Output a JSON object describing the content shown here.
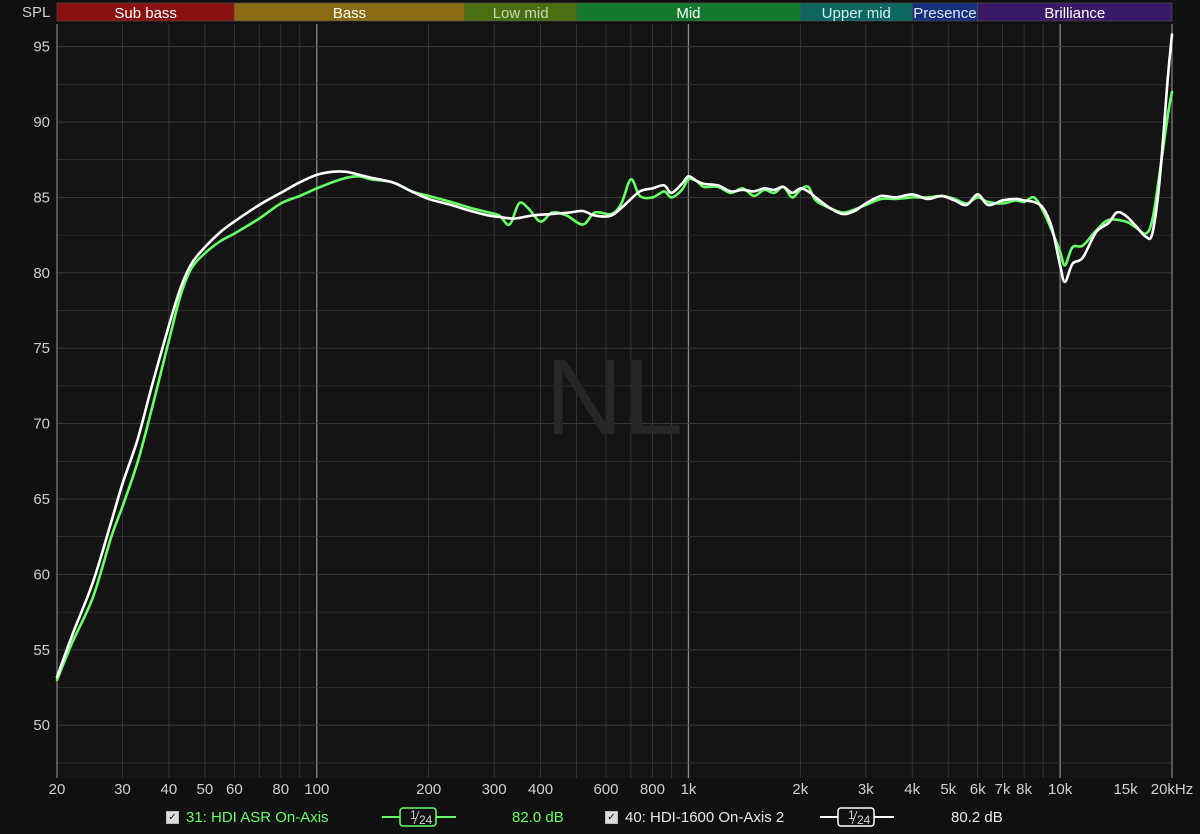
{
  "colors": {
    "background": "#101010",
    "plot_background": "#141414",
    "grid": "#3a3a3a",
    "series1": "#66ff66",
    "series2": "#ffffff",
    "watermark": "#262626"
  },
  "watermark": "NL",
  "bands": [
    {
      "label": "Sub bass",
      "from": 20,
      "to": 60,
      "color": "#8b1010",
      "text": "#ffffff"
    },
    {
      "label": "Bass",
      "from": 60,
      "to": 250,
      "color": "#8a6a12",
      "text": "#ffffff"
    },
    {
      "label": "Low mid",
      "from": 250,
      "to": 500,
      "color": "#4a6e12",
      "text": "#c8d8b0"
    },
    {
      "label": "Mid",
      "from": 500,
      "to": 2000,
      "color": "#137a2d",
      "text": "#ffffff"
    },
    {
      "label": "Upper mid",
      "from": 2000,
      "to": 4000,
      "color": "#0e6660",
      "text": "#d0f0f0"
    },
    {
      "label": "Presence",
      "from": 4000,
      "to": 6000,
      "color": "#15307a",
      "text": "#e0e8ff"
    },
    {
      "label": "Brilliance",
      "from": 6000,
      "to": 20000,
      "color": "#3a1a66",
      "text": "#ffffff"
    }
  ],
  "legend": [
    {
      "checkbox": "✓",
      "label": "31: HDI ASR On-Axis",
      "smoothing_num": "1",
      "smoothing_den": "24",
      "level": "82.0 dB",
      "color": "#66ff66"
    },
    {
      "checkbox": "✓",
      "label": "40: HDI-1600 On-Axis 2",
      "smoothing_num": "1",
      "smoothing_den": "24",
      "level": "80.2 dB",
      "color": "#ffffff"
    }
  ],
  "chart_data": {
    "type": "line",
    "ylabel": "SPL",
    "xscale": "log",
    "xlim": [
      20,
      20000
    ],
    "ylim": [
      46.5,
      96.5
    ],
    "grid": true,
    "yticks": [
      50,
      55,
      60,
      65,
      70,
      75,
      80,
      85,
      90,
      95
    ],
    "xticks": [
      {
        "v": 20,
        "label": "20"
      },
      {
        "v": 30,
        "label": "30"
      },
      {
        "v": 40,
        "label": "40"
      },
      {
        "v": 50,
        "label": "50"
      },
      {
        "v": 60,
        "label": "60"
      },
      {
        "v": 80,
        "label": "80"
      },
      {
        "v": 100,
        "label": "100"
      },
      {
        "v": 200,
        "label": "200"
      },
      {
        "v": 300,
        "label": "300"
      },
      {
        "v": 400,
        "label": "400"
      },
      {
        "v": 600,
        "label": "600"
      },
      {
        "v": 800,
        "label": "800"
      },
      {
        "v": 1000,
        "label": "1k"
      },
      {
        "v": 2000,
        "label": "2k"
      },
      {
        "v": 3000,
        "label": "3k"
      },
      {
        "v": 4000,
        "label": "4k"
      },
      {
        "v": 5000,
        "label": "5k"
      },
      {
        "v": 6000,
        "label": "6k"
      },
      {
        "v": 7000,
        "label": "7k"
      },
      {
        "v": 8000,
        "label": "8k"
      },
      {
        "v": 10000,
        "label": "10k"
      },
      {
        "v": 15000,
        "label": "15k"
      },
      {
        "v": 20000,
        "label": "20kHz"
      }
    ],
    "series": [
      {
        "name": "31: HDI ASR On-Axis",
        "color": "#66ff66",
        "points": [
          [
            20,
            53.0
          ],
          [
            22,
            55.5
          ],
          [
            25,
            58.5
          ],
          [
            28,
            62.5
          ],
          [
            30,
            64.5
          ],
          [
            33,
            67.5
          ],
          [
            36,
            71.0
          ],
          [
            40,
            75.5
          ],
          [
            43,
            78.5
          ],
          [
            46,
            80.3
          ],
          [
            50,
            81.3
          ],
          [
            55,
            82.1
          ],
          [
            60,
            82.6
          ],
          [
            70,
            83.6
          ],
          [
            80,
            84.6
          ],
          [
            90,
            85.1
          ],
          [
            100,
            85.6
          ],
          [
            110,
            86.0
          ],
          [
            120,
            86.3
          ],
          [
            130,
            86.4
          ],
          [
            140,
            86.2
          ],
          [
            160,
            86.0
          ],
          [
            180,
            85.4
          ],
          [
            200,
            85.1
          ],
          [
            230,
            84.7
          ],
          [
            260,
            84.3
          ],
          [
            290,
            84.0
          ],
          [
            310,
            83.8
          ],
          [
            330,
            83.2
          ],
          [
            350,
            84.6
          ],
          [
            370,
            84.3
          ],
          [
            400,
            83.4
          ],
          [
            430,
            84.0
          ],
          [
            470,
            83.8
          ],
          [
            520,
            83.2
          ],
          [
            560,
            84.0
          ],
          [
            620,
            83.9
          ],
          [
            660,
            84.6
          ],
          [
            700,
            86.2
          ],
          [
            740,
            85.1
          ],
          [
            800,
            85.0
          ],
          [
            860,
            85.4
          ],
          [
            900,
            85.0
          ],
          [
            960,
            85.5
          ],
          [
            1000,
            86.2
          ],
          [
            1050,
            86.1
          ],
          [
            1100,
            85.7
          ],
          [
            1200,
            85.7
          ],
          [
            1300,
            85.3
          ],
          [
            1400,
            85.6
          ],
          [
            1500,
            85.1
          ],
          [
            1600,
            85.5
          ],
          [
            1700,
            85.3
          ],
          [
            1800,
            85.7
          ],
          [
            1900,
            85.0
          ],
          [
            2000,
            85.5
          ],
          [
            2100,
            85.7
          ],
          [
            2200,
            84.8
          ],
          [
            2400,
            84.3
          ],
          [
            2600,
            84.0
          ],
          [
            2800,
            84.2
          ],
          [
            3000,
            84.5
          ],
          [
            3300,
            84.9
          ],
          [
            3600,
            84.9
          ],
          [
            4000,
            85.0
          ],
          [
            4400,
            85.0
          ],
          [
            4800,
            85.1
          ],
          [
            5200,
            84.9
          ],
          [
            5600,
            84.6
          ],
          [
            6000,
            85.0
          ],
          [
            6400,
            84.7
          ],
          [
            7000,
            84.6
          ],
          [
            7600,
            84.8
          ],
          [
            8000,
            84.7
          ],
          [
            8500,
            85.0
          ],
          [
            9000,
            84.1
          ],
          [
            9500,
            82.8
          ],
          [
            10000,
            81.4
          ],
          [
            10300,
            80.5
          ],
          [
            10800,
            81.7
          ],
          [
            11500,
            81.8
          ],
          [
            12500,
            82.8
          ],
          [
            13500,
            83.5
          ],
          [
            15000,
            83.4
          ],
          [
            16000,
            83.0
          ],
          [
            17000,
            82.6
          ],
          [
            17700,
            83.5
          ],
          [
            18500,
            86.5
          ],
          [
            19500,
            90.5
          ],
          [
            20000,
            92.0
          ]
        ]
      },
      {
        "name": "40: HDI-1600 On-Axis 2",
        "color": "#ffffff",
        "points": [
          [
            20,
            53.2
          ],
          [
            22,
            56.0
          ],
          [
            25,
            59.5
          ],
          [
            28,
            63.5
          ],
          [
            30,
            66.0
          ],
          [
            33,
            69.0
          ],
          [
            36,
            72.5
          ],
          [
            40,
            76.5
          ],
          [
            43,
            79.0
          ],
          [
            46,
            80.6
          ],
          [
            50,
            81.7
          ],
          [
            55,
            82.7
          ],
          [
            60,
            83.4
          ],
          [
            70,
            84.5
          ],
          [
            80,
            85.3
          ],
          [
            90,
            86.0
          ],
          [
            100,
            86.5
          ],
          [
            110,
            86.7
          ],
          [
            120,
            86.7
          ],
          [
            130,
            86.5
          ],
          [
            140,
            86.3
          ],
          [
            160,
            86.0
          ],
          [
            180,
            85.4
          ],
          [
            200,
            84.9
          ],
          [
            230,
            84.5
          ],
          [
            260,
            84.1
          ],
          [
            290,
            83.8
          ],
          [
            310,
            83.7
          ],
          [
            340,
            83.6
          ],
          [
            380,
            83.8
          ],
          [
            430,
            83.9
          ],
          [
            480,
            84.0
          ],
          [
            520,
            84.1
          ],
          [
            560,
            83.8
          ],
          [
            620,
            83.8
          ],
          [
            680,
            84.6
          ],
          [
            740,
            85.4
          ],
          [
            800,
            85.6
          ],
          [
            860,
            85.8
          ],
          [
            900,
            85.3
          ],
          [
            960,
            85.9
          ],
          [
            1000,
            86.4
          ],
          [
            1050,
            86.1
          ],
          [
            1100,
            85.9
          ],
          [
            1200,
            85.8
          ],
          [
            1300,
            85.4
          ],
          [
            1400,
            85.5
          ],
          [
            1500,
            85.4
          ],
          [
            1600,
            85.6
          ],
          [
            1700,
            85.5
          ],
          [
            1800,
            85.7
          ],
          [
            1900,
            85.3
          ],
          [
            2000,
            85.6
          ],
          [
            2100,
            85.4
          ],
          [
            2200,
            85.0
          ],
          [
            2400,
            84.3
          ],
          [
            2600,
            83.9
          ],
          [
            2800,
            84.1
          ],
          [
            3000,
            84.6
          ],
          [
            3300,
            85.1
          ],
          [
            3600,
            85.0
          ],
          [
            4000,
            85.2
          ],
          [
            4400,
            84.9
          ],
          [
            4800,
            85.1
          ],
          [
            5200,
            84.8
          ],
          [
            5600,
            84.5
          ],
          [
            6000,
            85.2
          ],
          [
            6400,
            84.5
          ],
          [
            7000,
            84.8
          ],
          [
            7600,
            84.9
          ],
          [
            8000,
            84.8
          ],
          [
            8500,
            84.7
          ],
          [
            9000,
            84.3
          ],
          [
            9500,
            83.0
          ],
          [
            10000,
            80.5
          ],
          [
            10300,
            79.4
          ],
          [
            10800,
            80.6
          ],
          [
            11500,
            81.0
          ],
          [
            12500,
            82.7
          ],
          [
            13500,
            83.3
          ],
          [
            14200,
            84.0
          ],
          [
            15000,
            83.8
          ],
          [
            16000,
            83.1
          ],
          [
            17000,
            82.4
          ],
          [
            17700,
            82.6
          ],
          [
            18500,
            86.0
          ],
          [
            19500,
            93.0
          ],
          [
            20000,
            95.8
          ]
        ]
      }
    ]
  }
}
